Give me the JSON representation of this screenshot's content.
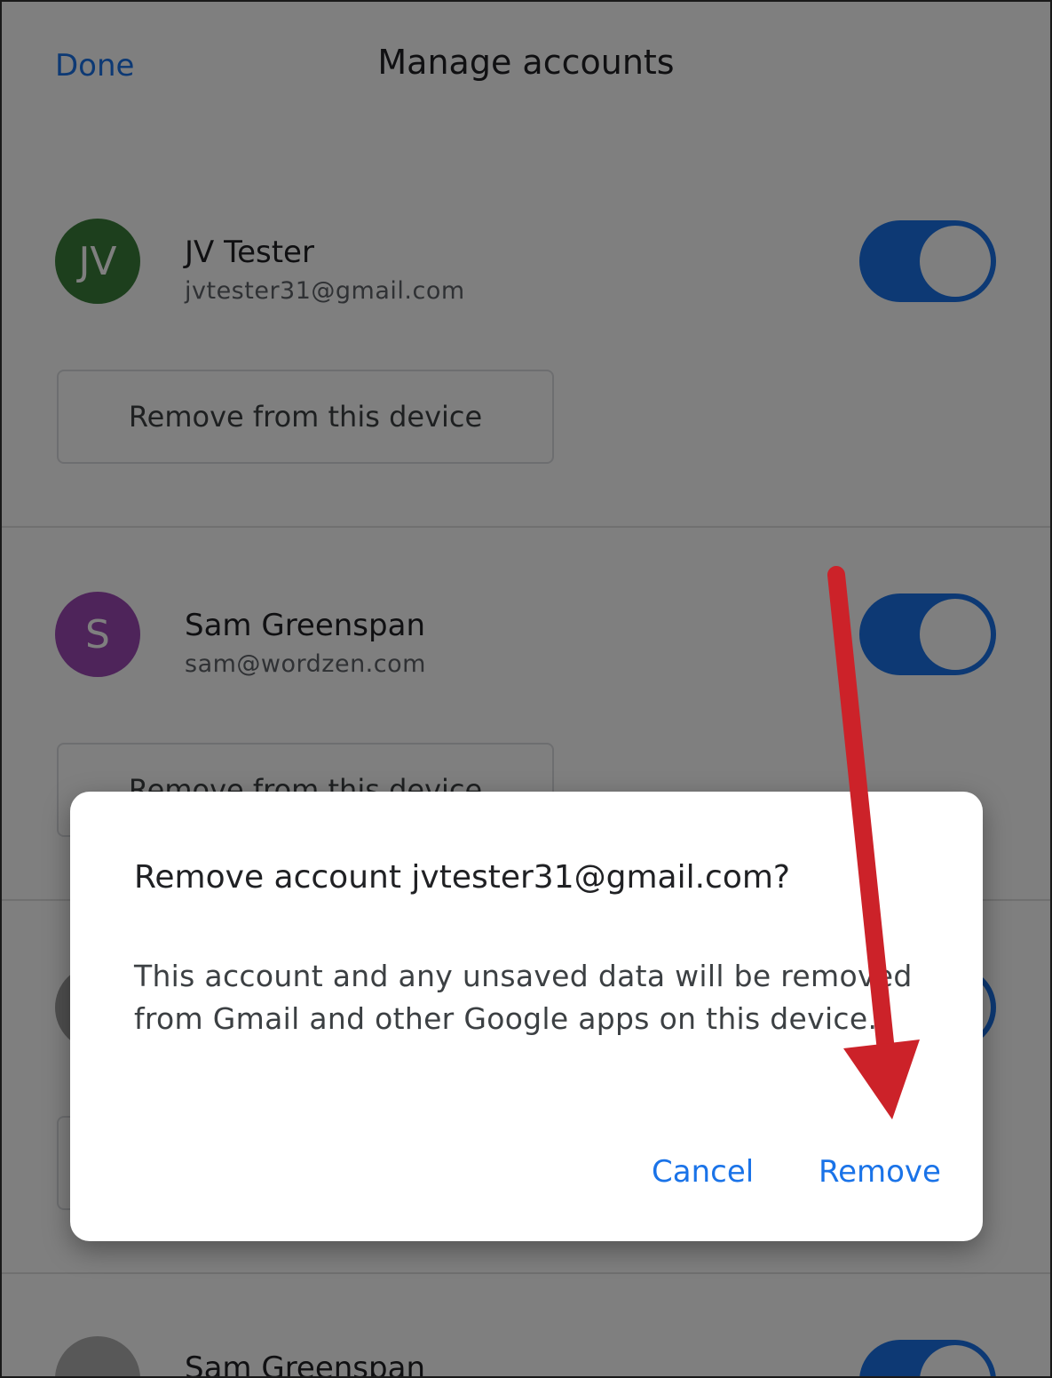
{
  "header": {
    "done_label": "Done",
    "title": "Manage accounts"
  },
  "accounts": [
    {
      "initials": "JV",
      "name": "JV Tester",
      "email": "jvtester31@gmail.com",
      "avatar_color": "#3a7f3a",
      "remove_label": "Remove from this device",
      "sync_on": true
    },
    {
      "initials": "S",
      "name": "Sam Greenspan",
      "email": "sam@wordzen.com",
      "avatar_color": "#9c48b4",
      "remove_label": "Remove from this device",
      "sync_on": true
    },
    {
      "initials": "",
      "name": "",
      "email": "",
      "avatar_color": "#9e9e9e",
      "remove_label": "",
      "sync_on": true
    },
    {
      "initials": "",
      "name": "Sam Greenspan",
      "email": "",
      "avatar_color": "#b0b0b0",
      "remove_label": "",
      "sync_on": true
    }
  ],
  "dialog": {
    "title": "Remove account jvtester31@gmail.com?",
    "body": "This account and any unsaved data will be removed from Gmail and other Google apps on this device.",
    "cancel_label": "Cancel",
    "remove_label": "Remove"
  },
  "colors": {
    "accent": "#1a73e8",
    "annotation_arrow": "#cc2229"
  }
}
